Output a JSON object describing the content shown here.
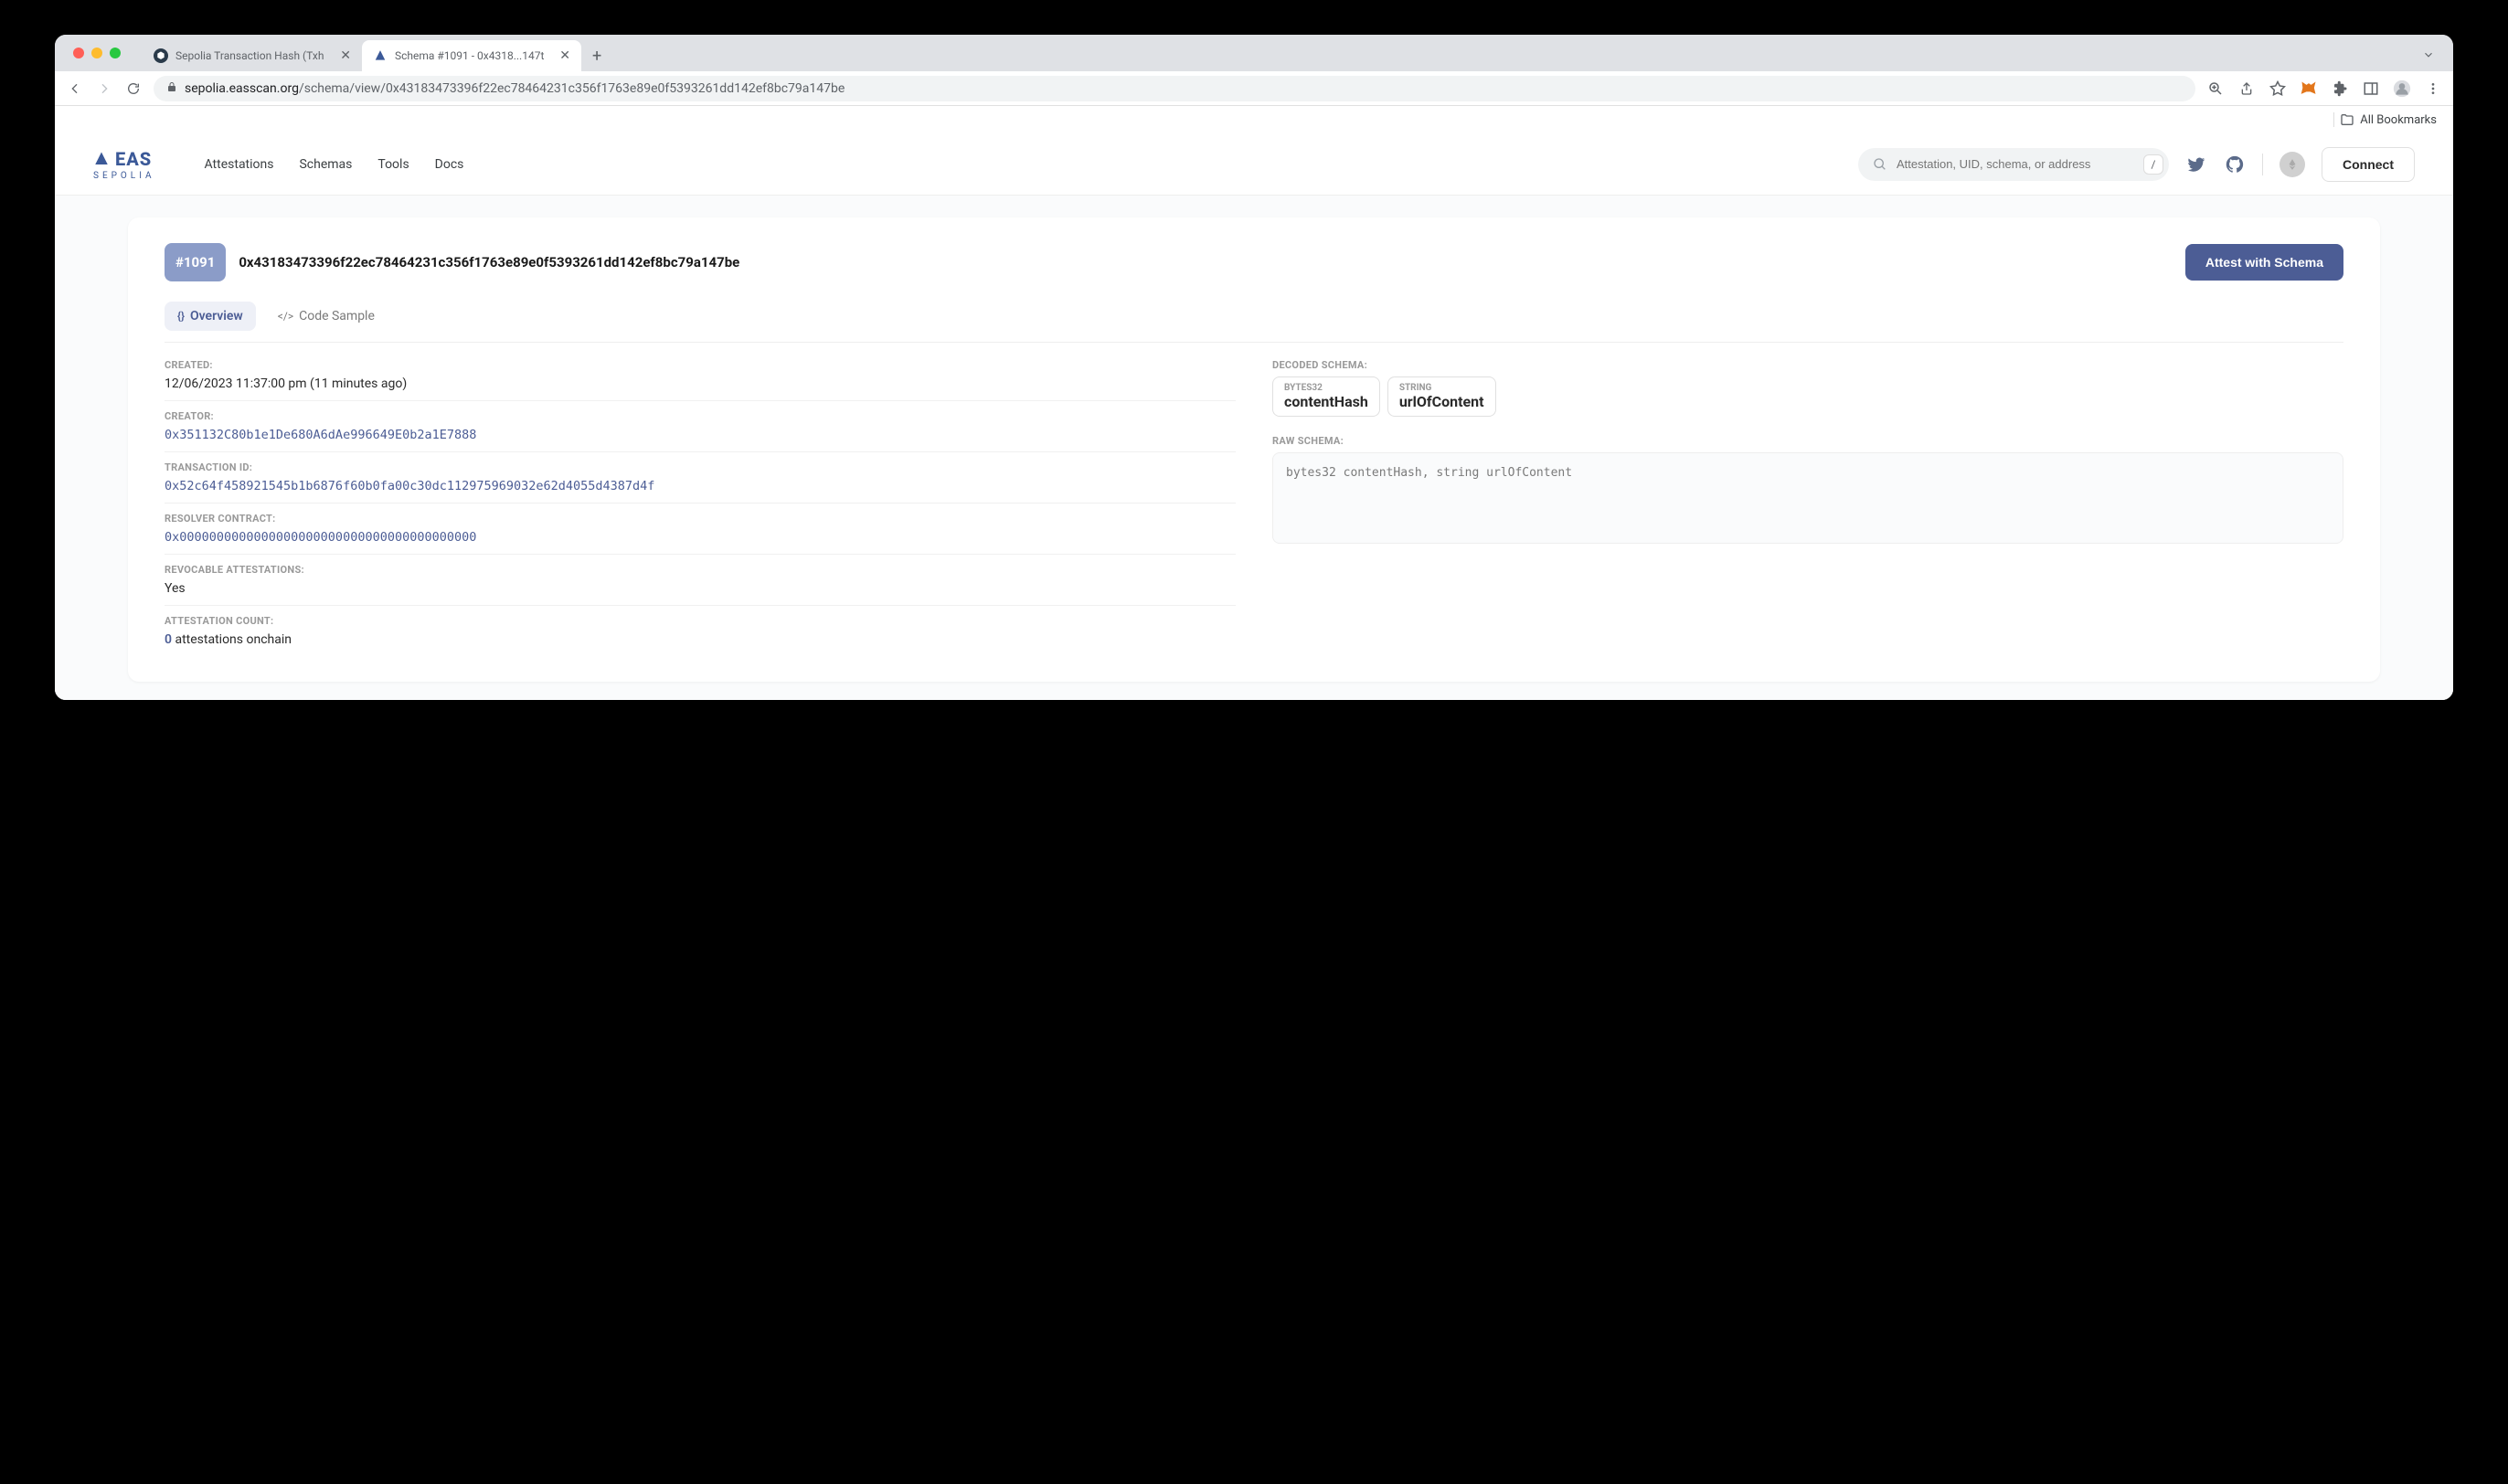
{
  "browser": {
    "tabs": [
      {
        "title": "Sepolia Transaction Hash (Txh",
        "active": false
      },
      {
        "title": "Schema #1091 - 0x4318...147t",
        "active": true
      }
    ],
    "url_host": "sepolia.easscan.org",
    "url_path": "/schema/view/0x43183473396f22ec78464231c356f1763e89e0f5393261dd142ef8bc79a147be",
    "bookmarks_label": "All Bookmarks"
  },
  "header": {
    "logo_main": "EAS",
    "logo_sub": "SEPOLIA",
    "nav": [
      "Attestations",
      "Schemas",
      "Tools",
      "Docs"
    ],
    "search_placeholder": "Attestation, UID, schema, or address",
    "slash_key": "/",
    "connect": "Connect"
  },
  "schema": {
    "badge": "#1091",
    "hash": "0x43183473396f22ec78464231c356f1763e89e0f5393261dd142ef8bc79a147be",
    "attest_button": "Attest with Schema",
    "tabs": {
      "overview": "Overview",
      "code_sample": "Code Sample"
    },
    "fields": {
      "created_label": "CREATED:",
      "created_value": "12/06/2023 11:37:00 pm (11 minutes ago)",
      "creator_label": "CREATOR:",
      "creator_value": "0x351132C80b1e1De680A6dAe996649E0b2a1E7888",
      "txn_label": "TRANSACTION ID:",
      "txn_value": "0x52c64f458921545b1b6876f60b0fa00c30dc112975969032e62d4055d4387d4f",
      "resolver_label": "RESOLVER CONTRACT:",
      "resolver_value": "0x0000000000000000000000000000000000000000",
      "revocable_label": "REVOCABLE ATTESTATIONS:",
      "revocable_value": "Yes",
      "count_label": "ATTESTATION COUNT:",
      "count_num": "0",
      "count_text": " attestations onchain"
    },
    "decoded_label": "DECODED SCHEMA:",
    "decoded": [
      {
        "type": "BYTES32",
        "name": "contentHash"
      },
      {
        "type": "STRING",
        "name": "urlOfContent"
      }
    ],
    "raw_label": "RAW SCHEMA:",
    "raw_value": "bytes32 contentHash, string urlOfContent"
  }
}
